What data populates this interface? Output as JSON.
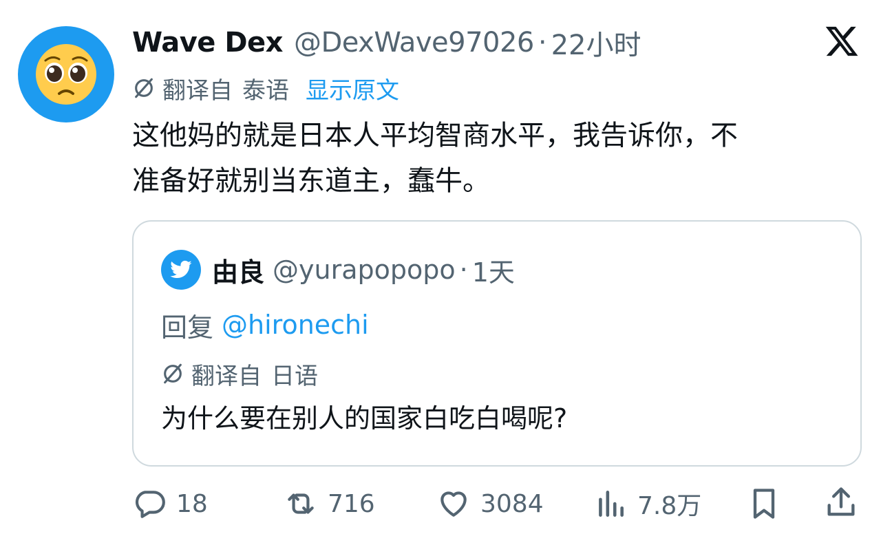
{
  "tweet": {
    "author": {
      "display_name": "Wave Dex",
      "handle": "@DexWave97026",
      "separator": "·",
      "time": "22小时",
      "avatar_icon": "pleading-face-emoji"
    },
    "translation": {
      "label": "翻译自",
      "language": "泰语",
      "show_original": "显示原文"
    },
    "text_line1": "这他妈的就是日本人平均智商水平，我告诉你，不",
    "text_line2": "准备好就别当东道主，蠢牛。"
  },
  "quoted": {
    "author": {
      "display_name": "由良",
      "handle": "@yurapopopo",
      "separator": "·",
      "time": "1天",
      "avatar_icon": "twitter-bird-icon"
    },
    "reply_prefix": "回复",
    "reply_to": "@hironechi",
    "translation": {
      "label": "翻译自",
      "language": "日语"
    },
    "text": "为什么要在别人的国家白吃白喝呢?"
  },
  "actions": {
    "replies": "18",
    "retweets": "716",
    "likes": "3084",
    "views": "7.8万"
  },
  "colors": {
    "accent": "#1d9bf0",
    "text": "#0f1419",
    "secondary": "#536471",
    "border": "#cfd9de"
  }
}
